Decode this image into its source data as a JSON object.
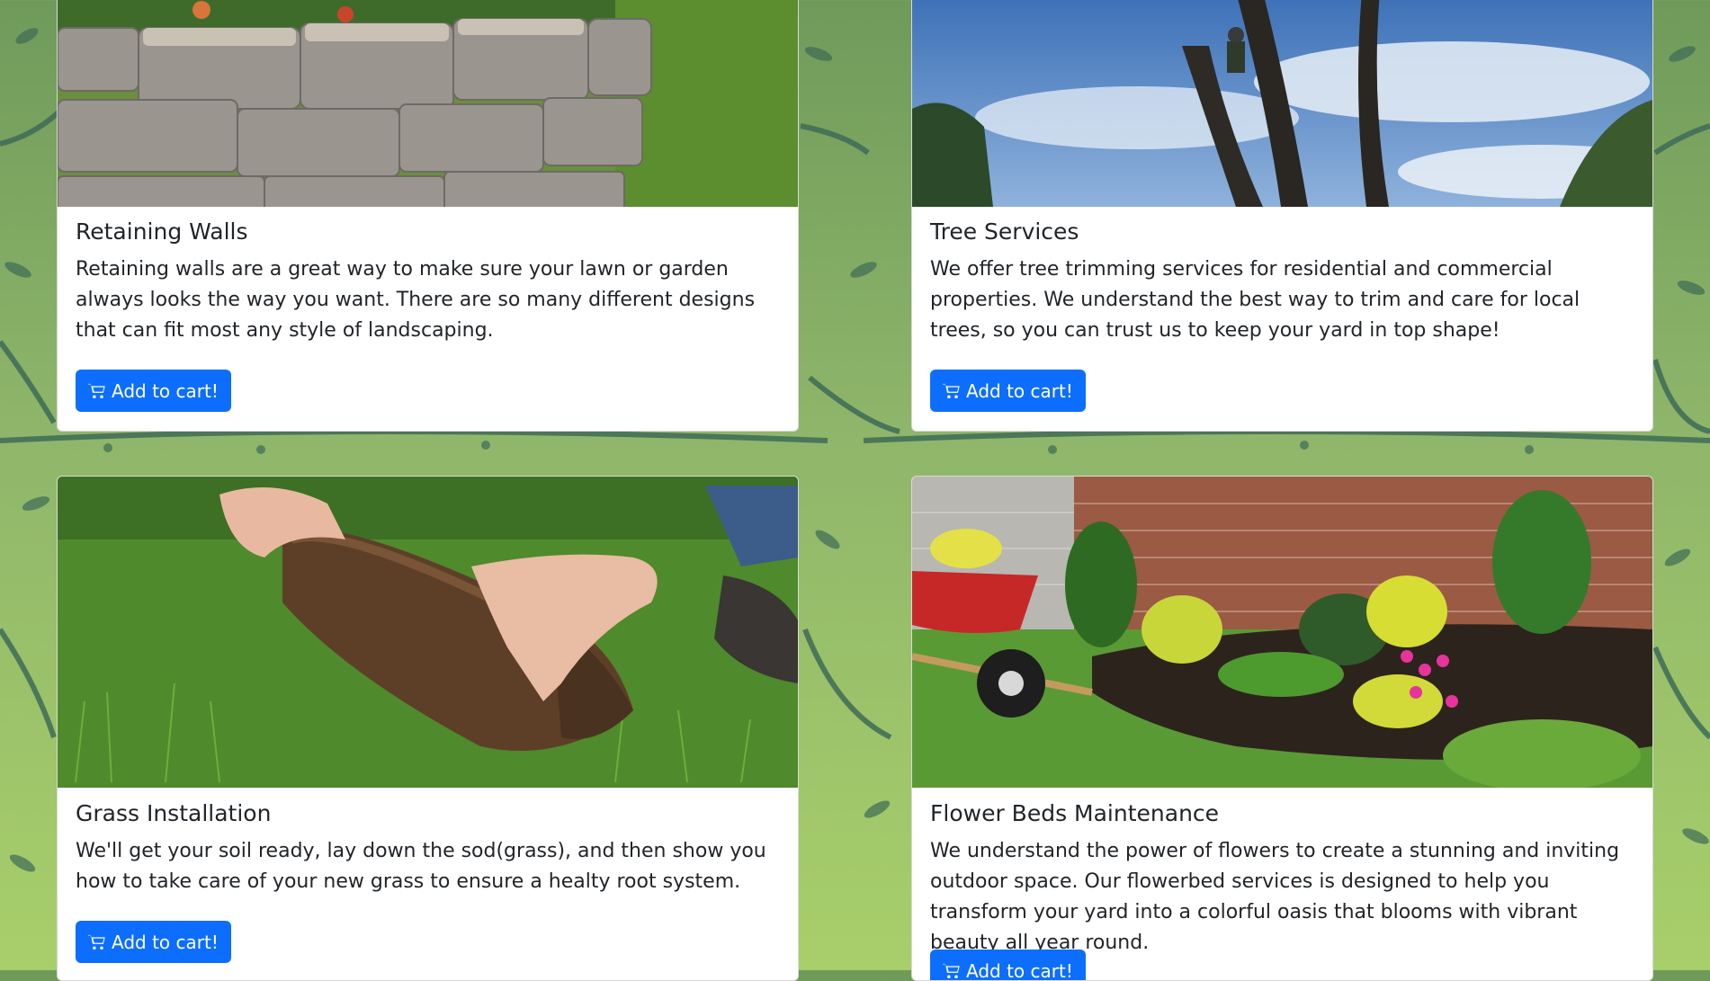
{
  "cards": [
    {
      "title": "Retaining Walls",
      "text": "Retaining walls are a great way to make sure your lawn or garden always looks the way you want. There are so many different designs that can fit most any style of landscaping.",
      "button": "Add to cart!",
      "image_alt": "stacked stone retaining wall with flowers"
    },
    {
      "title": "Tree Services",
      "text": "We offer tree trimming services for residential and commercial properties. We understand the best way to trim and care for local trees, so you can trust us to keep your yard in top shape!",
      "button": "Add to cart!",
      "image_alt": "arborist climbing a tree trunk against a blue sky"
    },
    {
      "title": "Grass Installation",
      "text": "We'll get your soil ready, lay down the sod(grass), and then show you how to take care of your new grass to ensure a healty root system.",
      "button": "Add to cart!",
      "image_alt": "hands rolling out a strip of sod"
    },
    {
      "title": "Flower Beds Maintenance",
      "text": "We understand the power of flowers to create a stunning and inviting outdoor space. Our flowerbed services is designed to help you transform your yard into a colorful oasis that blooms with vibrant beauty all year round.",
      "button": "Add to cart!",
      "image_alt": "landscaped flower bed with shrubs and a wheelbarrow"
    }
  ],
  "colors": {
    "accent": "#0d6efd",
    "background_green": "#8fb66a",
    "leaf_dark": "#3e6b57"
  },
  "icons": {
    "cart": "cart-icon"
  }
}
